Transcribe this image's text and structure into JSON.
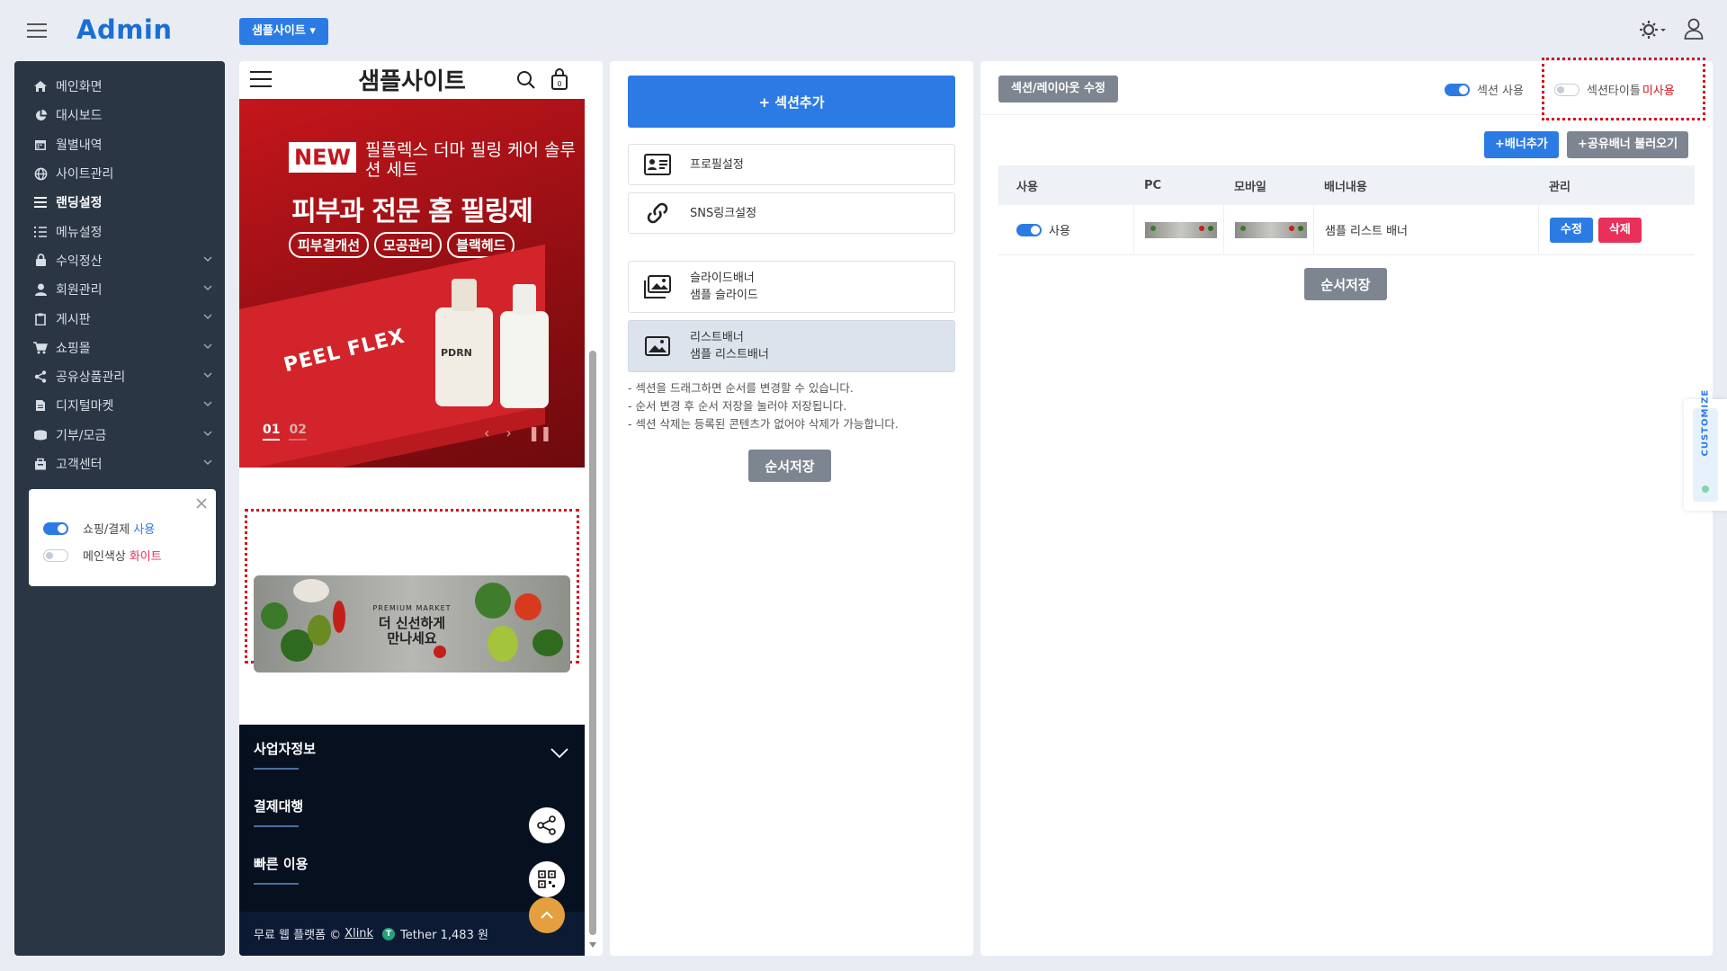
{
  "app": {
    "logo": "Admin"
  },
  "header": {
    "site_dropdown": "샘플사이트"
  },
  "sidebar": {
    "items": [
      {
        "label": "메인화면",
        "icon": "home-icon"
      },
      {
        "label": "대시보드",
        "icon": "pie-chart-icon"
      },
      {
        "label": "월별내역",
        "icon": "calendar-icon"
      },
      {
        "label": "사이트관리",
        "icon": "globe-icon"
      },
      {
        "label": "랜딩설정",
        "icon": "list-icon",
        "active": true
      },
      {
        "label": "메뉴설정",
        "icon": "list-ordered-icon"
      },
      {
        "label": "수익정산",
        "icon": "lock-icon",
        "expandable": true
      },
      {
        "label": "회원관리",
        "icon": "user-icon",
        "expandable": true
      },
      {
        "label": "게시판",
        "icon": "clipboard-icon",
        "expandable": true
      },
      {
        "label": "쇼핑몰",
        "icon": "cart-icon",
        "expandable": true
      },
      {
        "label": "공유상품관리",
        "icon": "share-icon",
        "expandable": true
      },
      {
        "label": "디지털마켓",
        "icon": "file-icon",
        "expandable": true
      },
      {
        "label": "기부/모금",
        "icon": "coins-icon",
        "expandable": true
      },
      {
        "label": "고객센터",
        "icon": "support-icon",
        "expandable": true
      }
    ],
    "settings": {
      "shopping_label": "쇼핑/결제",
      "shopping_value": "사용",
      "color_label": "메인색상",
      "color_value": "화이트"
    }
  },
  "preview": {
    "site_title": "샘플사이트",
    "hero": {
      "badge": "NEW",
      "subtitle": "필플렉스 더마 필링 케어 솔루션 세트",
      "title": "피부과 전문 홈 필링제",
      "tags": [
        "피부결개선",
        "모공관리",
        "블랙헤드"
      ],
      "box_text": "PEEL FLEX",
      "bottle_label": "PDRN",
      "slide_current": "01",
      "slide_next": "02"
    },
    "banner": {
      "small": "PREMIUM MARKET",
      "line1": "더 신선하게",
      "line2": "만나세요"
    },
    "footer": {
      "items": [
        "사업자정보",
        "결제대행",
        "빠른 이용"
      ],
      "bottom_prefix": "무료 웹 플랫폼 ©",
      "bottom_link": "Xlink",
      "tether_symbol": "T",
      "tether_text": "Tether 1,483 원"
    }
  },
  "sections": {
    "add_button": "+ 섹션추가",
    "cards": [
      {
        "icon": "profile-card-icon",
        "line1": "프로필설정",
        "line2": ""
      },
      {
        "icon": "link-icon",
        "line1": "SNS링크설정",
        "line2": ""
      },
      {
        "icon": "images-icon",
        "line1": "슬라이드배너",
        "line2": "샘플 슬라이드"
      },
      {
        "icon": "image-icon",
        "line1": "리스트배너",
        "line2": "샘플 리스트배너",
        "selected": true
      }
    ],
    "notes": [
      "- 섹션을 드래그하면 순서를 변경할 수 있습니다.",
      "- 순서 변경 후 순서 저장을 눌러야 저장됩니다.",
      "- 섹션 삭제는 등록된 콘텐츠가 없어야 삭제가 가능합니다."
    ],
    "save_button": "순서저장"
  },
  "editor": {
    "title": "섹션/레이아웃 수정",
    "section_use_label": "섹션 사용",
    "section_title_label": "섹션타이틀",
    "section_title_value": "미사용",
    "add_banner": "+배너추가",
    "load_shared": "+공유배너 불러오기",
    "columns": [
      "사용",
      "PC",
      "모바일",
      "배너내용",
      "관리"
    ],
    "rows": [
      {
        "use": "사용",
        "content": "샘플 리스트 배너",
        "edit": "수정",
        "delete": "삭제"
      }
    ],
    "save_button": "순서저장"
  },
  "customize": {
    "label": "CUSTOMIZE"
  },
  "colors": {
    "primary": "#2c7be5",
    "sidebar": "#2a3644",
    "danger": "#e8305a",
    "highlight": "#d6141d"
  }
}
